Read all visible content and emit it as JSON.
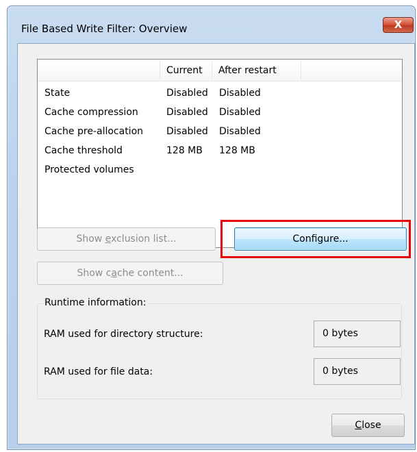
{
  "window": {
    "title": "File Based Write Filter: Overview",
    "close_glyph": "X"
  },
  "table": {
    "columns": [
      "",
      "Current",
      "After restart"
    ],
    "rows": [
      {
        "label": "State",
        "current": "Disabled",
        "after": "Disabled"
      },
      {
        "label": "Cache compression",
        "current": "Disabled",
        "after": "Disabled"
      },
      {
        "label": "Cache pre-allocation",
        "current": "Disabled",
        "after": "Disabled"
      },
      {
        "label": "Cache threshold",
        "current": "128 MB",
        "after": "128 MB"
      },
      {
        "label": "Protected volumes",
        "current": "",
        "after": ""
      }
    ]
  },
  "buttons": {
    "exclusion_pre": "Show ",
    "exclusion_u": "e",
    "exclusion_post": "xclusion list...",
    "configure": "Configure...",
    "cache_pre": "Show c",
    "cache_u": "a",
    "cache_post": "che content...",
    "close_u": "C",
    "close_post": "lose"
  },
  "runtime": {
    "title": "Runtime information:",
    "ram_dir_label": "RAM used for directory structure:",
    "ram_dir_value": "0 bytes",
    "ram_file_label": "RAM used for file data:",
    "ram_file_value": "0 bytes"
  },
  "colors": {
    "highlight": "#e8000b",
    "title_bar": "#bcd3ee"
  }
}
